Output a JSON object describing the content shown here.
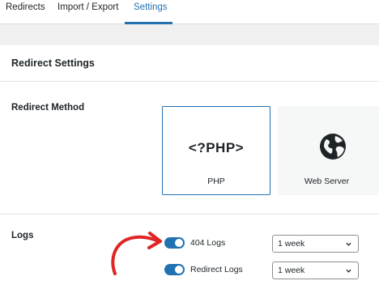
{
  "tabs": [
    {
      "label": "Redirects",
      "active": false
    },
    {
      "label": "Import / Export",
      "active": false
    },
    {
      "label": "Settings",
      "active": true
    }
  ],
  "card": {
    "title": "Redirect Settings"
  },
  "redirect_method": {
    "label": "Redirect Method",
    "options": [
      {
        "label": "PHP",
        "glyph": "<?PHP>",
        "selected": true,
        "icon": "php-icon"
      },
      {
        "label": "Web Server",
        "selected": false,
        "icon": "globe-icon"
      }
    ]
  },
  "logs": {
    "label": "Logs",
    "items": [
      {
        "label": "404 Logs",
        "enabled": true,
        "retention": "1 week"
      },
      {
        "label": "Redirect Logs",
        "enabled": true,
        "retention": "1 week"
      }
    ]
  },
  "colors": {
    "accent": "#2271b1",
    "annotation_arrow": "#e02424",
    "background": "#f0f0f1"
  }
}
